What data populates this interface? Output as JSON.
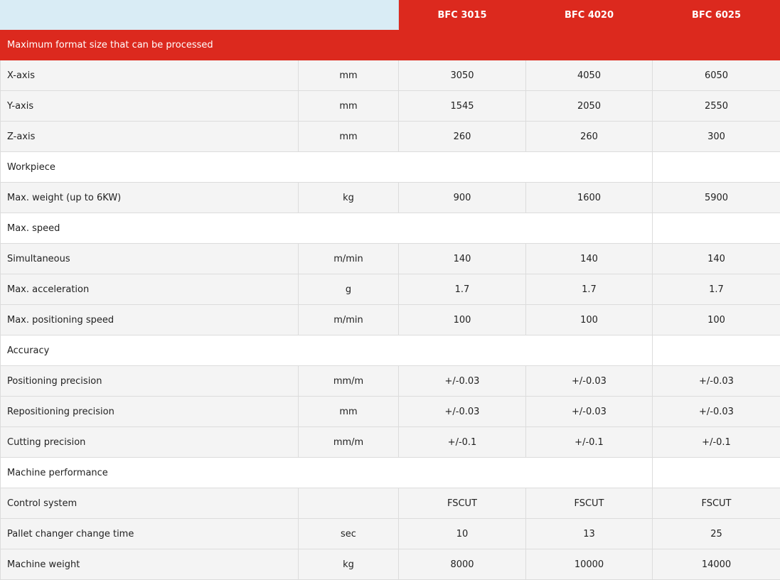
{
  "models": [
    "BFC 3015",
    "BFC 4020",
    "BFC 6025"
  ],
  "rows": [
    {
      "type": "section-red",
      "label": "Maximum format size that can be processed"
    },
    {
      "type": "data",
      "label": "X-axis",
      "unit": "mm",
      "values": [
        "3050",
        "4050",
        "6050"
      ]
    },
    {
      "type": "data",
      "label": "Y-axis",
      "unit": "mm",
      "values": [
        "1545",
        "2050",
        "2550"
      ]
    },
    {
      "type": "data",
      "label": "Z-axis",
      "unit": "mm",
      "values": [
        "260",
        "260",
        "300"
      ]
    },
    {
      "type": "section",
      "label": "Workpiece"
    },
    {
      "type": "data",
      "label": "Max. weight (up to 6KW)",
      "unit": "kg",
      "values": [
        "900",
        "1600",
        "5900"
      ]
    },
    {
      "type": "section",
      "label": "Max. speed"
    },
    {
      "type": "data",
      "label": "Simultaneous",
      "unit": "m/min",
      "values": [
        "140",
        "140",
        "140"
      ]
    },
    {
      "type": "data",
      "label": "Max. acceleration",
      "unit": "g",
      "values": [
        "1.7",
        "1.7",
        "1.7"
      ]
    },
    {
      "type": "data",
      "label": "Max. positioning speed",
      "unit": "m/min",
      "values": [
        "100",
        "100",
        "100"
      ]
    },
    {
      "type": "section",
      "label": "Accuracy"
    },
    {
      "type": "data",
      "label": "Positioning precision",
      "unit": "mm/m",
      "values": [
        "+/-0.03",
        "+/-0.03",
        "+/-0.03"
      ]
    },
    {
      "type": "data",
      "label": "Repositioning precision",
      "unit": "mm",
      "values": [
        "+/-0.03",
        "+/-0.03",
        "+/-0.03"
      ]
    },
    {
      "type": "data",
      "label": "Cutting precision",
      "unit": "mm/m",
      "values": [
        "+/-0.1",
        "+/-0.1",
        "+/-0.1"
      ]
    },
    {
      "type": "section",
      "label": "Machine performance"
    },
    {
      "type": "data",
      "label": "Control system",
      "unit": "",
      "values": [
        "FSCUT",
        "FSCUT",
        "FSCUT"
      ]
    },
    {
      "type": "data",
      "label": "Pallet changer change time",
      "unit": "sec",
      "values": [
        "10",
        "13",
        "25"
      ]
    },
    {
      "type": "data",
      "label": "Machine weight",
      "unit": "kg",
      "values": [
        "8000",
        "10000",
        "14000"
      ]
    }
  ],
  "colors": {
    "header_red": "#dc291e",
    "header_blank": "#d9ecf5",
    "row_bg": "#f4f4f4",
    "section_bg": "#ffffff"
  }
}
